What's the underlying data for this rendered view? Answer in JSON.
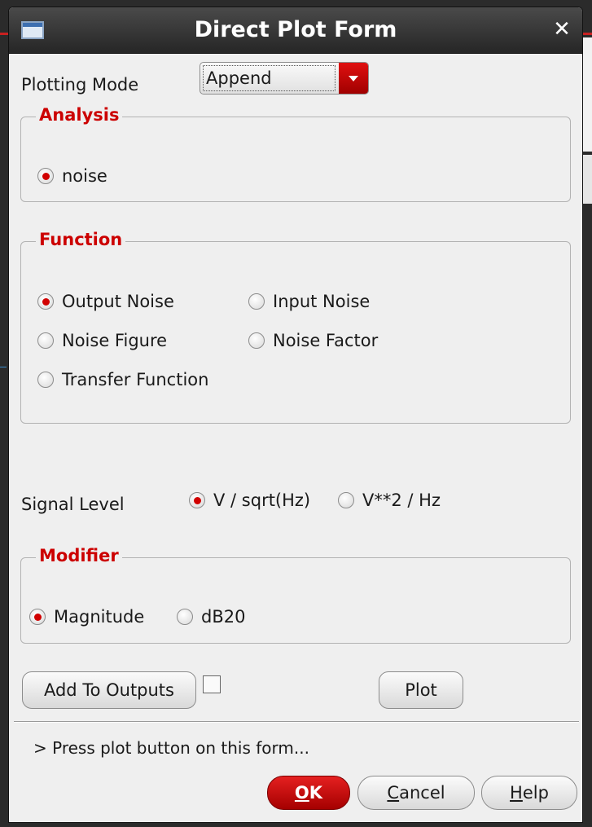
{
  "window": {
    "title": "Direct Plot Form"
  },
  "plotting_mode": {
    "label": "Plotting Mode",
    "value": "Append"
  },
  "analysis": {
    "title": "Analysis",
    "options": [
      {
        "label": "noise",
        "selected": true
      }
    ]
  },
  "function": {
    "title": "Function",
    "options": [
      {
        "label": "Output Noise",
        "selected": true
      },
      {
        "label": "Input Noise",
        "selected": false
      },
      {
        "label": "Noise Figure",
        "selected": false
      },
      {
        "label": "Noise Factor",
        "selected": false
      },
      {
        "label": "Transfer Function",
        "selected": false
      }
    ]
  },
  "signal_level": {
    "label": "Signal Level",
    "options": [
      {
        "label": "V / sqrt(Hz)",
        "selected": true
      },
      {
        "label": "V**2 / Hz",
        "selected": false
      }
    ]
  },
  "modifier": {
    "title": "Modifier",
    "options": [
      {
        "label": "Magnitude",
        "selected": true
      },
      {
        "label": "dB20",
        "selected": false
      }
    ]
  },
  "buttons": {
    "add_to_outputs": "Add To Outputs",
    "add_to_outputs_checked": false,
    "plot": "Plot",
    "ok": {
      "mnemonic": "O",
      "rest": "K"
    },
    "cancel": {
      "mnemonic": "C",
      "rest": "ancel"
    },
    "help": {
      "mnemonic": "H",
      "rest": "elp"
    }
  },
  "status": {
    "message": "> Press plot button on this form..."
  },
  "colors": {
    "accent": "#cc0000",
    "titlebar": "#262626",
    "background": "#efefef"
  },
  "icons": {
    "window": "window-icon",
    "close": "close-icon",
    "dropdown": "chevron-down-icon"
  }
}
